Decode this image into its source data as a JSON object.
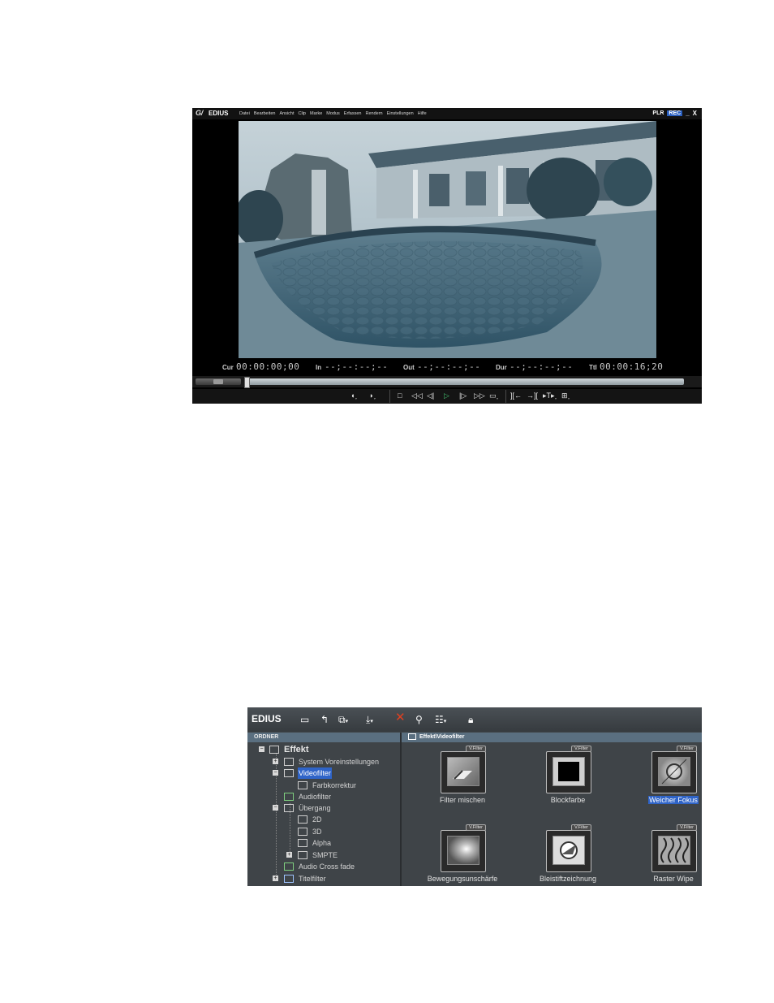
{
  "player": {
    "logo": "EDIUS",
    "menus": [
      "Datei",
      "Bearbeiten",
      "Ansicht",
      "Clip",
      "Marke",
      "Modus",
      "Erfassen",
      "Rendern",
      "Einstellungen",
      "Hilfe"
    ],
    "plr": "PLR",
    "rec": "REC",
    "minimize": "_",
    "close": "X",
    "timecodes": {
      "cur_label": "Cur",
      "cur_value": "00:00:00;00",
      "in_label": "In",
      "in_value": "--;--:--;--",
      "out_label": "Out",
      "out_value": "--;--:--;--",
      "dur_label": "Dur",
      "dur_value": "--;--:--;--",
      "ttl_label": "Ttl",
      "ttl_value": "00:00:16;20"
    },
    "controls": [
      "set-in-icon",
      "set-out-icon",
      "stop-icon",
      "rewind-icon",
      "step-back-icon",
      "play-icon",
      "step-forward-icon",
      "fast-forward-icon",
      "loop-icon",
      "insert-icon",
      "overwrite-icon",
      "split-icon",
      "export-icon"
    ]
  },
  "bin": {
    "logo": "EDIUS",
    "folder_header": "ORDNER",
    "content_header": "Effekt\\Videofilter",
    "tree": {
      "root": "Effekt",
      "system": "System Voreinstellungen",
      "videofilter": "Videofilter",
      "farbkorrektur": "Farbkorrektur",
      "audiofilter": "Audiofilter",
      "uebergang": "Übergang",
      "t2d": "2D",
      "t3d": "3D",
      "alpha": "Alpha",
      "smpte": "SMPTE",
      "audiocross": "Audio Cross fade",
      "titelfilter": "Titelfilter"
    },
    "tag": "V.Filter",
    "effects": [
      {
        "name": "Filter mischen"
      },
      {
        "name": "Blockfarbe"
      },
      {
        "name": "Weicher Fokus"
      },
      {
        "name": "Bewegungsunschärfe"
      },
      {
        "name": "Bleistiftzeichnung"
      },
      {
        "name": "Raster Wipe"
      }
    ]
  }
}
